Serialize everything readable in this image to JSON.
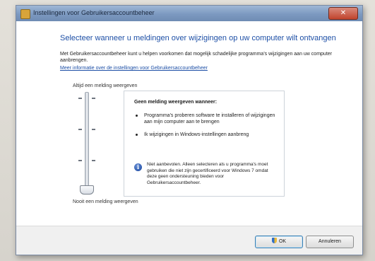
{
  "window": {
    "title": "Instellingen voor Gebruikersaccountbeheer",
    "close_label": "✕"
  },
  "dialog": {
    "heading": "Selecteer wanneer u meldingen over wijzigingen op uw computer wilt ontvangen",
    "intro": "Met Gebruikersaccountbeheer kunt u helpen voorkomen dat mogelijk schadelijke programma's wijzigingen aan uw computer aanbrengen.",
    "more_link": "Meer informatie over de instellingen voor Gebruikersaccountbeheer"
  },
  "slider": {
    "top_label": "Altijd een melding weergeven",
    "bottom_label": "Nooit een melding weergeven",
    "level_count": 4,
    "selected_level": 1
  },
  "info_box": {
    "title": "Geen melding weergeven wanneer:",
    "bullets": [
      "Programma's proberen software te installeren of wijzigingen aan mijn computer aan te brengen",
      "Ik wijzigingen in Windows-instellingen aanbreng"
    ],
    "note": "Niet aanbevolen. Alleen selecteren als u programma's moet gebruiken die niet zijn gecertificeerd voor Windows 7 omdat deze geen ondersteuning bieden voor Gebruikersaccountbeheer."
  },
  "footer": {
    "ok_label": "OK",
    "cancel_label": "Annuleren"
  },
  "icons": {
    "app": "control-panel-icon",
    "close": "close-icon",
    "info": "info-icon",
    "shield": "uac-shield-icon"
  },
  "colors": {
    "heading": "#1d4fa6",
    "link": "#1d4fa6",
    "close_button": "#c1442d"
  }
}
